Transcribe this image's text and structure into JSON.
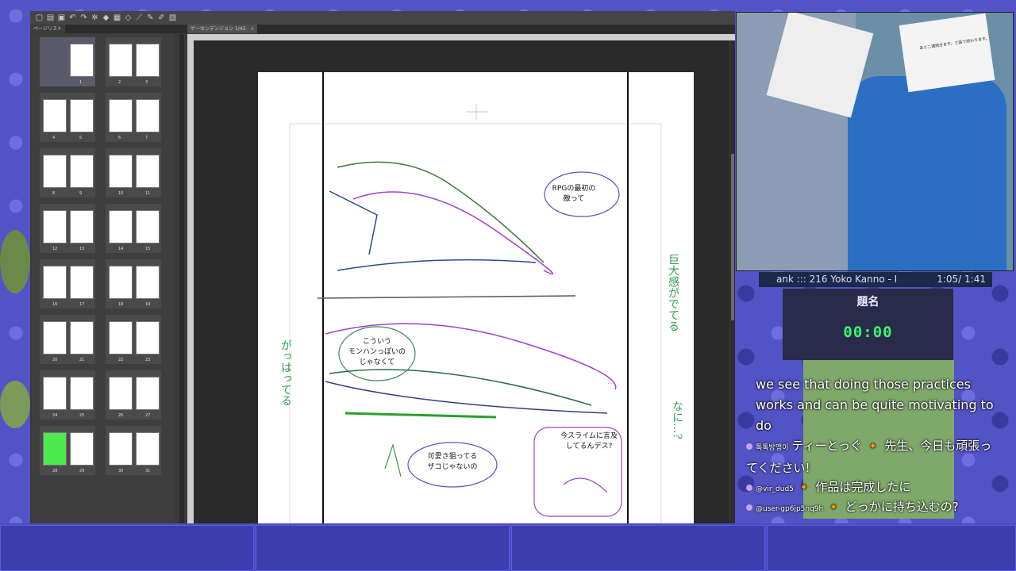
{
  "app": {
    "page_list_tab": "ページリスト",
    "document_tab": "ゲーセンデンジョン 1/42"
  },
  "pages": [
    {
      "left": "",
      "right": "1"
    },
    {
      "left": "2",
      "right": "3"
    },
    {
      "left": "4",
      "right": "5"
    },
    {
      "left": "6",
      "right": "7"
    },
    {
      "left": "8",
      "right": "9"
    },
    {
      "left": "10",
      "right": "11"
    },
    {
      "left": "12",
      "right": "13"
    },
    {
      "left": "14",
      "right": "15"
    },
    {
      "left": "16",
      "right": "17"
    },
    {
      "left": "18",
      "right": "19"
    },
    {
      "left": "20",
      "right": "21"
    },
    {
      "left": "22",
      "right": "23"
    },
    {
      "left": "24",
      "right": "25"
    },
    {
      "left": "26",
      "right": "27"
    },
    {
      "left": "28",
      "right": "29"
    },
    {
      "left": "30",
      "right": "31"
    }
  ],
  "manga": {
    "bubble1_line1": "RPGの最初の",
    "bubble1_line2": "敵って",
    "bubble2_line1": "こういう",
    "bubble2_line2": "モンハンっぽいの",
    "bubble2_line3": "じゃなくて",
    "bubble3_line1": "可愛さ狙ってる",
    "bubble3_line2": "ザコじゃないの",
    "bubble4_line1": "今スライムに言及",
    "bubble4_line2": "してるんデス?",
    "note_right": "巨大感がでてる",
    "note_left": "がっはってる",
    "note_right2": "なに...?"
  },
  "webcam": {
    "paper_text": "あと二週続きます。三話で終わります。"
  },
  "music": {
    "track": "ank  :::  216 Yoko Kanno - I",
    "time": "1:05/ 1:41"
  },
  "timer": {
    "title": "題名",
    "clock": "00:00"
  },
  "chat": {
    "caption": "we see that doing those practices works and can be quite motivating to do",
    "messages": [
      {
        "user": "톡톡방맹이",
        "text": "ティーとっぐ 🔸 先生、今日も頑張ってください!"
      },
      {
        "user": "@vir_dud5",
        "text": "🔸 作品は完成したに"
      },
      {
        "user": "@user-gp6jp5nq9h",
        "text": "🔸 どっかに持ち込むの?"
      }
    ]
  }
}
